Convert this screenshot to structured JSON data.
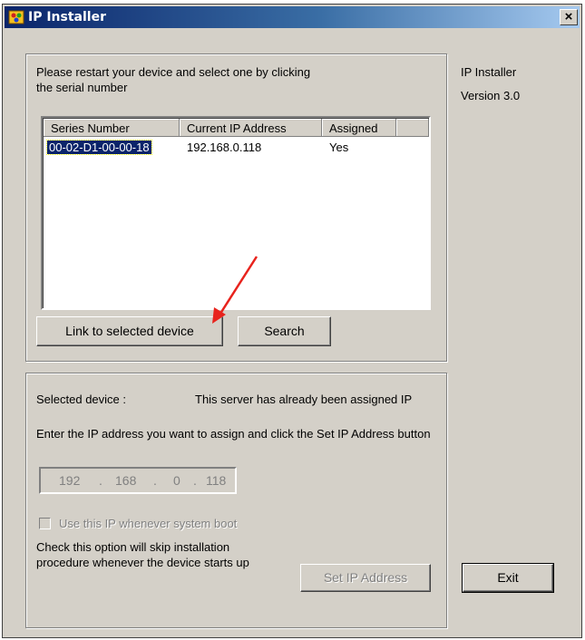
{
  "window": {
    "title": "IP Installer",
    "close_glyph": "×"
  },
  "app_info": {
    "name": "IP Installer",
    "version": "Version 3.0"
  },
  "device_list": {
    "instruction": "Please restart your device and select one by clicking the serial number",
    "columns": [
      "Series Number",
      "Current IP Address",
      "Assigned"
    ],
    "rows": [
      {
        "serial": "00-02-D1-00-00-18",
        "ip": "192.168.0.118",
        "assigned": "Yes"
      }
    ],
    "link_button": "Link to selected device",
    "search_button": "Search"
  },
  "assign": {
    "selected_label": "Selected device :",
    "selected_status": "This server has already been assigned IP",
    "instruction": "Enter the IP address you want to assign and click the Set IP Address button",
    "ip": {
      "o1": "192",
      "o2": "168",
      "o3": "0",
      "o4": "118",
      "dot": "."
    },
    "checkbox_label": "Use this IP whenever system boot",
    "checkbox_checked": false,
    "hint": "Check this option will skip installation procedure whenever the device starts up",
    "set_button": "Set IP Address"
  },
  "exit_button": "Exit",
  "colors": {
    "title_gradient_start": "#0a246a",
    "title_gradient_end": "#a6caf0",
    "face": "#d4d0c8",
    "selection": "#0a246a",
    "arrow": "#e8231d"
  }
}
